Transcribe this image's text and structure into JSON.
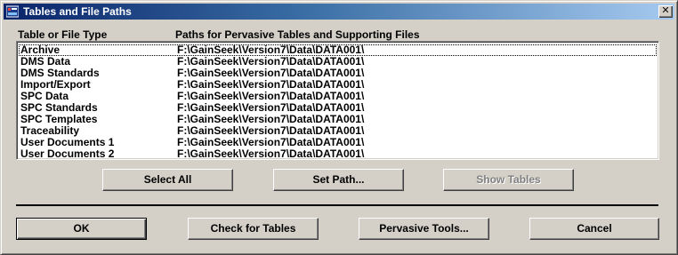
{
  "window": {
    "title": "Tables and File Paths",
    "close_symbol": "✕",
    "title_icon": "app-icon"
  },
  "columns": {
    "type_header": "Table or File Type",
    "path_header": "Paths for Pervasive Tables and Supporting Files"
  },
  "rows": [
    {
      "type": "Archive",
      "path": "F:\\GainSeek\\Version7\\Data\\DATA001\\"
    },
    {
      "type": "DMS Data",
      "path": "F:\\GainSeek\\Version7\\Data\\DATA001\\"
    },
    {
      "type": "DMS Standards",
      "path": "F:\\GainSeek\\Version7\\Data\\DATA001\\"
    },
    {
      "type": "Import/Export",
      "path": "F:\\GainSeek\\Version7\\Data\\DATA001\\"
    },
    {
      "type": "SPC Data",
      "path": "F:\\GainSeek\\Version7\\Data\\DATA001\\"
    },
    {
      "type": "SPC Standards",
      "path": "F:\\GainSeek\\Version7\\Data\\DATA001\\"
    },
    {
      "type": "SPC Templates",
      "path": "F:\\GainSeek\\Version7\\Data\\DATA001\\"
    },
    {
      "type": "Traceability",
      "path": "F:\\GainSeek\\Version7\\Data\\DATA001\\"
    },
    {
      "type": "User Documents 1",
      "path": "F:\\GainSeek\\Version7\\Data\\DATA001\\"
    },
    {
      "type": "User Documents 2",
      "path": "F:\\GainSeek\\Version7\\Data\\DATA001\\"
    }
  ],
  "buttons": {
    "select_all": "Select All",
    "set_path": "Set Path...",
    "show_tables": "Show Tables",
    "ok": "OK",
    "check_for_tables": "Check for Tables",
    "pervasive_tools": "Pervasive Tools...",
    "cancel": "Cancel"
  },
  "colors": {
    "title_gradient_start": "#0a246a",
    "title_gradient_end": "#a6caf0",
    "face": "#d4d0c8",
    "disabled_text": "#808080"
  }
}
